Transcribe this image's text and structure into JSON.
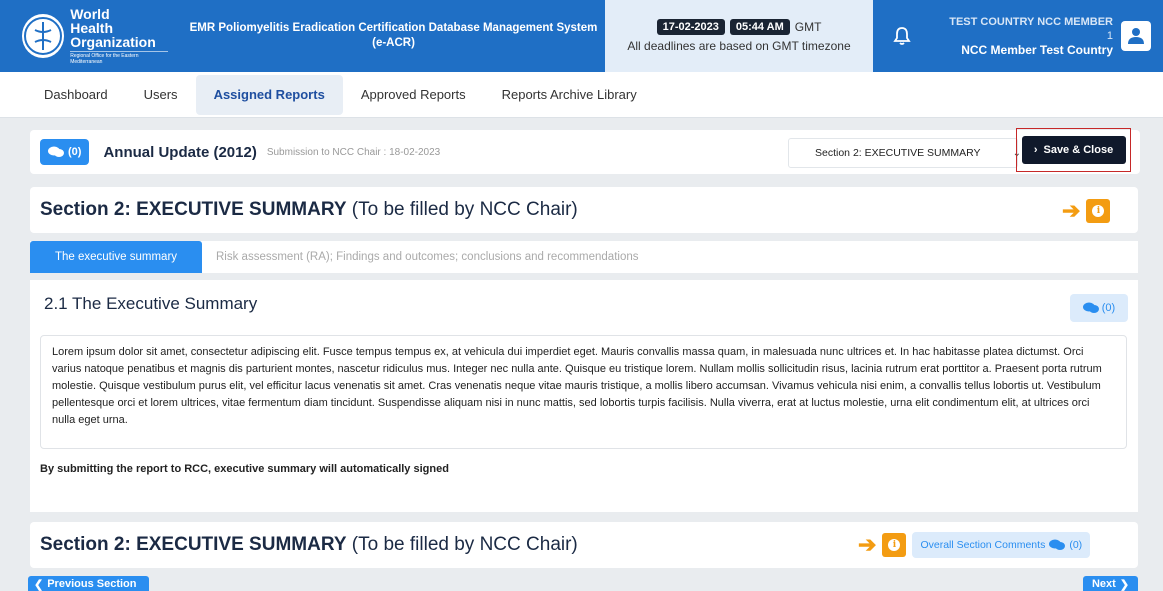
{
  "header": {
    "org_name": "World Health Organization",
    "org_region": "Regional Office for the Eastern Mediterranean",
    "system_title": "EMR Poliomyelitis Eradication Certification Database Management System (e-ACR)",
    "date": "17-02-2023",
    "time": "05:44 AM",
    "timezone": "GMT",
    "deadline_note": "All deadlines are based on GMT timezone",
    "user_role": "TEST COUNTRY NCC MEMBER",
    "user_number": "1",
    "user_name": "NCC Member Test Country"
  },
  "nav": {
    "items": [
      {
        "label": "Dashboard"
      },
      {
        "label": "Users"
      },
      {
        "label": "Assigned Reports"
      },
      {
        "label": "Approved Reports"
      },
      {
        "label": "Reports Archive Library"
      }
    ],
    "active": "Assigned Reports"
  },
  "toolbar": {
    "comments_count": "(0)",
    "report_title": "Annual Update (2012)",
    "submission_note": "Submission to NCC Chair : 18-02-2023",
    "section_select_value": "Section 2: EXECUTIVE SUMMARY",
    "save_close_label": "Save & Close"
  },
  "section": {
    "title_bold": "Section 2: EXECUTIVE SUMMARY",
    "title_paren": "(To be filled by NCC Chair)"
  },
  "tabs": [
    {
      "label": "The executive summary",
      "active": true
    },
    {
      "label": "Risk assessment (RA); Findings and outcomes; conclusions and recommendations",
      "active": false
    }
  ],
  "content": {
    "title": "2.1 The Executive Summary",
    "comments_count": "(0)",
    "body": "Lorem ipsum dolor sit amet, consectetur adipiscing elit. Fusce tempus tempus ex, at vehicula dui imperdiet eget. Mauris convallis massa quam, in malesuada nunc ultrices et. In hac habitasse platea dictumst. Orci varius natoque penatibus et magnis dis parturient montes, nascetur ridiculus mus. Integer nec nulla ante. Quisque eu tristique lorem. Nullam mollis sollicitudin risus, lacinia rutrum erat porttitor a. Praesent porta rutrum molestie. Quisque vestibulum purus elit, vel efficitur lacus venenatis sit amet. Cras venenatis neque vitae mauris tristique, a mollis libero accumsan. Vivamus vehicula nisi enim, a convallis tellus lobortis ut. Vestibulum pellentesque orci et lorem ultrices, vitae fermentum diam tincidunt. Suspendisse aliquam nisi in nunc mattis, sed lobortis turpis facilisis. Nulla viverra, erat at luctus molestie, urna elit condimentum elit, at ultrices orci nulla eget urna.",
    "note": "By submitting the report to RCC, executive summary will automatically signed"
  },
  "footer_section": {
    "title_bold": "Section 2: EXECUTIVE SUMMARY",
    "title_paren": "(To be filled by NCC Chair)",
    "overall_comments_label": "Overall Section Comments",
    "overall_comments_count": "(0)"
  },
  "pager": {
    "prev_label": "Previous Section",
    "next_label": "Next"
  },
  "colors": {
    "primary": "#1f6fc5",
    "accent_blue": "#2a8ef0",
    "warning": "#f39c12",
    "dark": "#10192b",
    "highlight_border": "#c62828"
  },
  "icons": [
    "who-emblem-icon",
    "bell-icon",
    "user-icon",
    "comments-icon",
    "chevron-right-icon",
    "chevron-down-icon",
    "arrow-right-icon",
    "info-icon",
    "chevron-left-icon"
  ]
}
